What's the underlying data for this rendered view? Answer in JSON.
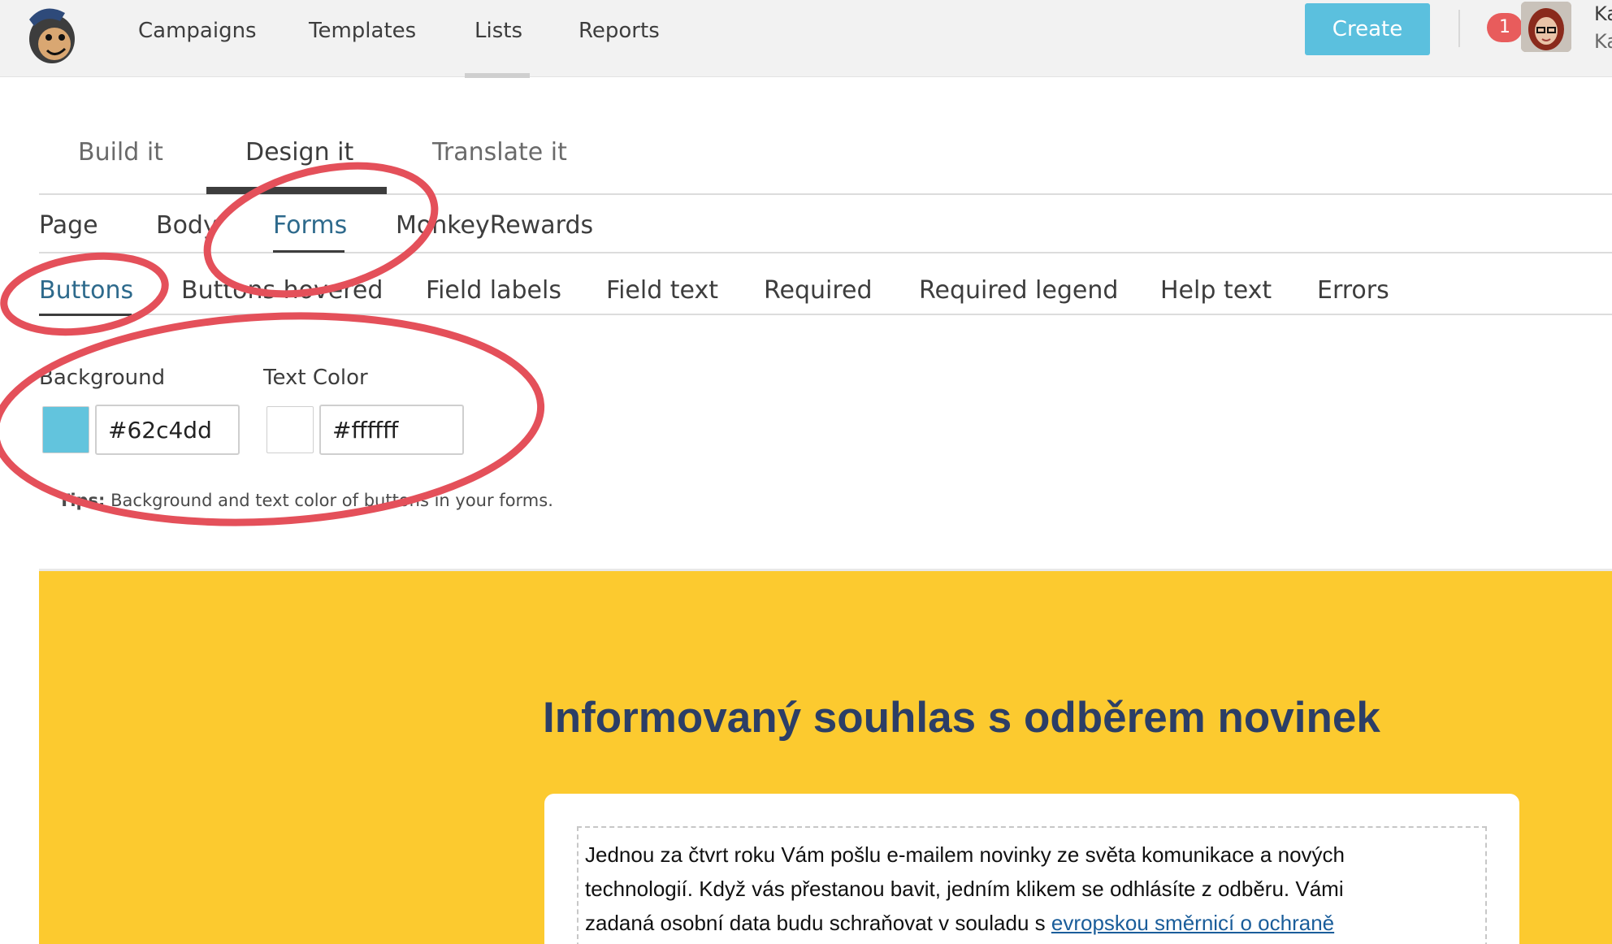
{
  "topnav": {
    "items": [
      "Campaigns",
      "Templates",
      "Lists",
      "Reports"
    ],
    "active": "Lists",
    "create_label": "Create",
    "notification_count": "1",
    "user_name": "Ka",
    "user_sub": "Ka"
  },
  "tabs_primary": {
    "items": [
      "Build it",
      "Design it",
      "Translate it"
    ],
    "active": "Design it"
  },
  "tabs_secondary": {
    "items": [
      "Page",
      "Body",
      "Forms",
      "MonkeyRewards"
    ],
    "active": "Forms"
  },
  "tabs_tertiary": {
    "items": [
      "Buttons",
      "Buttons hovered",
      "Field labels",
      "Field text",
      "Required",
      "Required legend",
      "Help text",
      "Errors"
    ],
    "active": "Buttons"
  },
  "colors": {
    "background": {
      "label": "Background",
      "value": "#62c4dd"
    },
    "text_color": {
      "label": "Text Color",
      "value": "#ffffff"
    }
  },
  "tips": {
    "prefix": "Tips:",
    "text": "Background and text color of buttons in your forms."
  },
  "preview": {
    "title": "Informovaný souhlas s odběrem novinek",
    "body_lines": [
      "Jednou za čtvrt roku Vám pošlu e-mailem novinky ze světa komunikace a nových",
      "technologií. Když vás přestanou bavit, jedním klikem se odhlásíte z odběru. Vámi",
      "zadaná osobní data budu schraňovat v souladu s "
    ],
    "link_text": "evropskou směrnicí o ochraně",
    "background_color": "#fcca2f",
    "title_color": "#2c3e66"
  },
  "annotation_color": "#e4505a"
}
